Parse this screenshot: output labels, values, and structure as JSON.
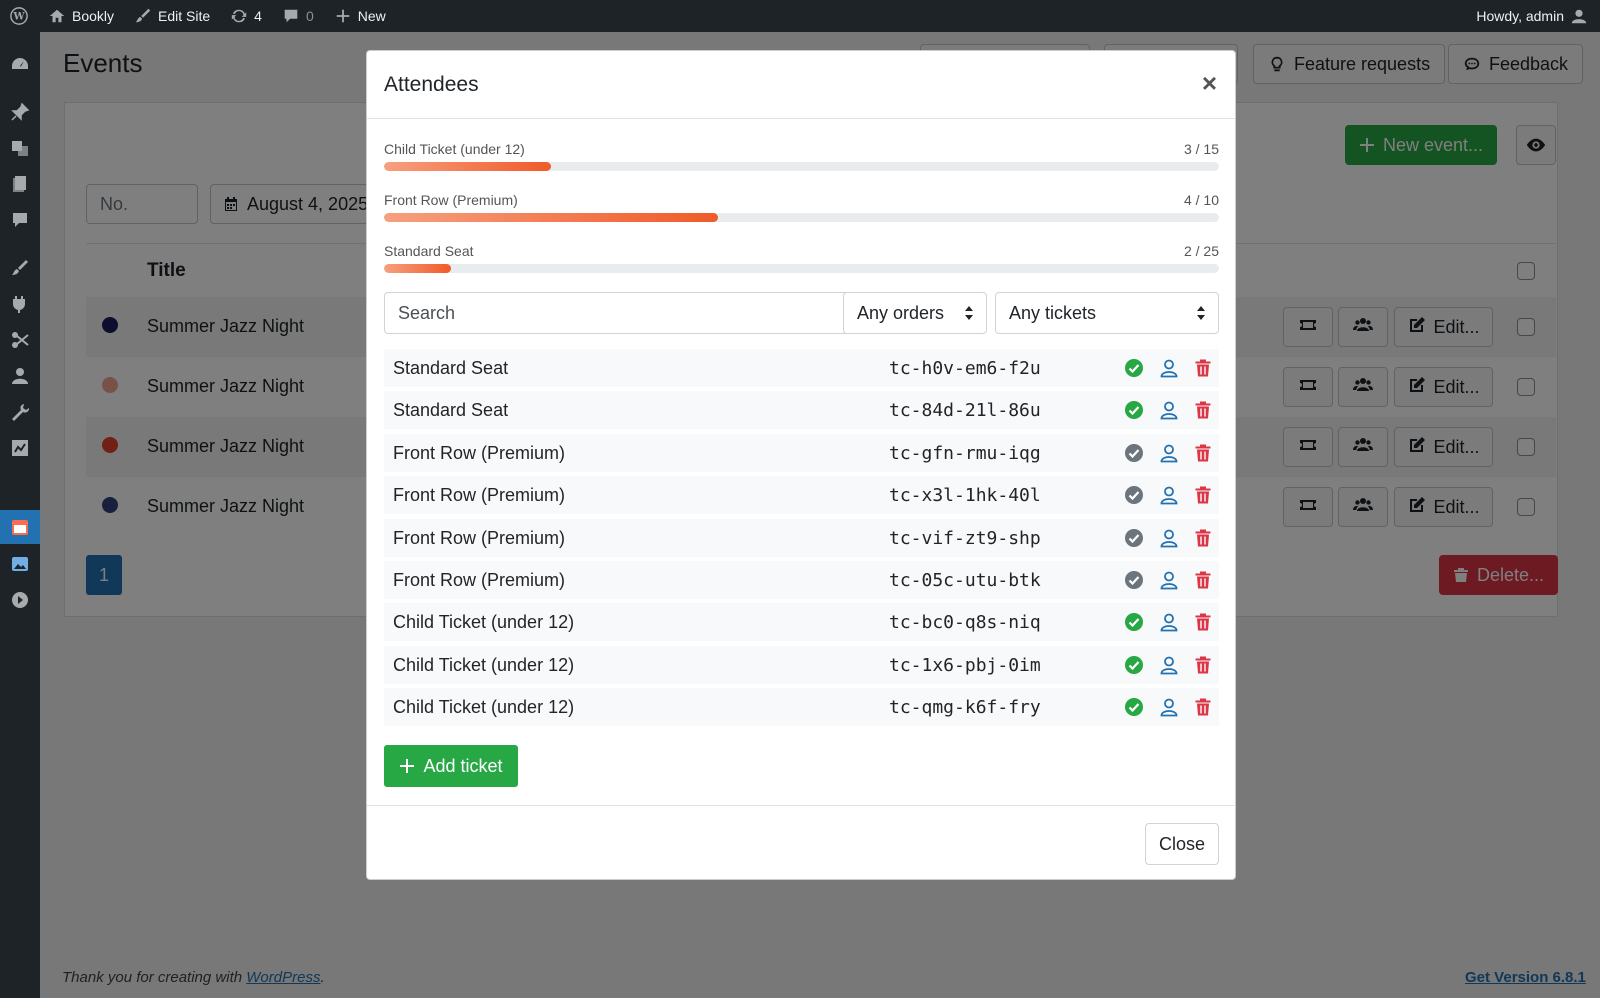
{
  "adminbar": {
    "site": "Bookly",
    "edit_site": "Edit Site",
    "updates": "4",
    "comments": "0",
    "new": "New",
    "greeting": "Howdy, admin"
  },
  "page": {
    "title": "Events",
    "feature_requests": "Feature requests",
    "feedback": "Feedback",
    "new_event": "New event...",
    "filter_no_placeholder": "No.",
    "filter_date": "August 4, 2025",
    "col_title": "Title",
    "rows": [
      {
        "title": "Summer Jazz Night",
        "color": "#1e1b5e",
        "edit": "Edit..."
      },
      {
        "title": "Summer Jazz Night",
        "color": "#f2a293",
        "edit": "Edit..."
      },
      {
        "title": "Summer Jazz Night",
        "color": "#e0402a",
        "edit": "Edit..."
      },
      {
        "title": "Summer Jazz Night",
        "color": "#33407a",
        "edit": "Edit..."
      }
    ],
    "page_number": "1",
    "delete": "Delete...",
    "footer_prefix": "Thank you for creating with ",
    "footer_link": "WordPress",
    "footer_suffix": ".",
    "version": "Get Version 6.8.1"
  },
  "modal": {
    "title": "Attendees",
    "close_x": "×",
    "progress": [
      {
        "label": "Child Ticket (under 12)",
        "count": "3 / 15",
        "value": 0.2
      },
      {
        "label": "Front Row (Premium)",
        "count": "4 / 10",
        "value": 0.4
      },
      {
        "label": "Standard Seat",
        "count": "2 / 25",
        "value": 0.08
      }
    ],
    "search_placeholder": "Search",
    "orders_select": "Any orders",
    "tickets_select": "Any tickets",
    "attendees": [
      {
        "type": "Standard Seat",
        "code": "tc-h0v-em6-f2u",
        "status": "checked-in"
      },
      {
        "type": "Standard Seat",
        "code": "tc-84d-21l-86u",
        "status": "checked-in"
      },
      {
        "type": "Front Row (Premium)",
        "code": "tc-gfn-rmu-iqg",
        "status": "not-checked-in"
      },
      {
        "type": "Front Row (Premium)",
        "code": "tc-x3l-1hk-40l",
        "status": "not-checked-in"
      },
      {
        "type": "Front Row (Premium)",
        "code": "tc-vif-zt9-shp",
        "status": "not-checked-in"
      },
      {
        "type": "Front Row (Premium)",
        "code": "tc-05c-utu-btk",
        "status": "not-checked-in"
      },
      {
        "type": "Child Ticket (under 12)",
        "code": "tc-bc0-q8s-niq",
        "status": "checked-in"
      },
      {
        "type": "Child Ticket (under 12)",
        "code": "tc-1x6-pbj-0im",
        "status": "checked-in"
      },
      {
        "type": "Child Ticket (under 12)",
        "code": "tc-qmg-k6f-fry",
        "status": "checked-in"
      }
    ],
    "add_ticket": "Add ticket",
    "close": "Close"
  },
  "colors": {
    "checked_in": "#28a745",
    "not_checked_in": "#6c757d",
    "person_icon": "#2271b1",
    "delete_icon": "#dc3545",
    "accent_green": "#28a745"
  },
  "icons": {
    "status": "check-circle-icon",
    "attendee": "user-icon",
    "delete": "trash-icon"
  }
}
